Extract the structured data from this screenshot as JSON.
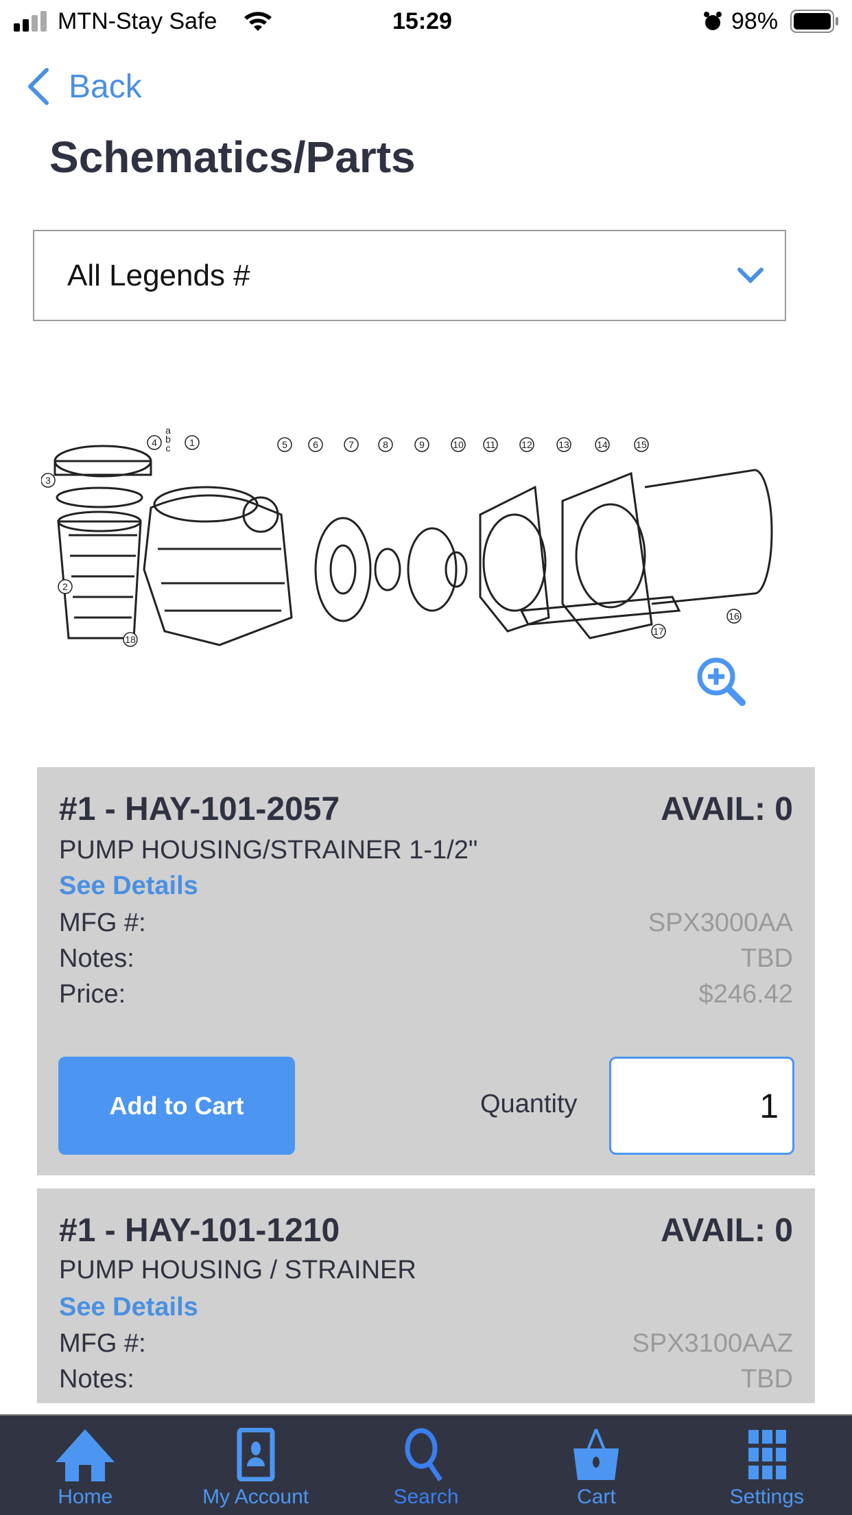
{
  "status_bar": {
    "carrier": "MTN-Stay Safe",
    "time": "15:29",
    "battery": "98%"
  },
  "nav": {
    "back_label": "Back"
  },
  "page": {
    "title": "Schematics/Parts"
  },
  "legend_select": {
    "selected": "All Legends #"
  },
  "schematic": {
    "callouts": [
      "1",
      "2",
      "3",
      "4",
      "5",
      "6",
      "7",
      "8",
      "9",
      "10",
      "11",
      "12",
      "13",
      "14",
      "15",
      "16",
      "17",
      "18"
    ],
    "sub_labels": [
      "a",
      "b",
      "c"
    ]
  },
  "parts": [
    {
      "title": "#1 - HAY-101-2057",
      "avail": "AVAIL: 0",
      "description": "PUMP HOUSING/STRAINER 1-1/2\"",
      "details_link": "See Details",
      "mfg_label": "MFG #:",
      "mfg": "SPX3000AA",
      "notes_label": "Notes:",
      "notes": "TBD",
      "price_label": "Price:",
      "price": "$246.42",
      "add_label": "Add to Cart",
      "qty_label": "Quantity",
      "qty": "1"
    },
    {
      "title": "#1 - HAY-101-1210",
      "avail": "AVAIL: 0",
      "description": "PUMP HOUSING / STRAINER",
      "details_link": "See Details",
      "mfg_label": "MFG #:",
      "mfg": "SPX3100AAZ",
      "notes_label": "Notes:",
      "notes": "TBD"
    }
  ],
  "tabs": [
    {
      "label": "Home",
      "icon": "home-icon"
    },
    {
      "label": "My Account",
      "icon": "account-icon"
    },
    {
      "label": "Search",
      "icon": "search-icon"
    },
    {
      "label": "Cart",
      "icon": "cart-icon"
    },
    {
      "label": "Settings",
      "icon": "grid-icon"
    }
  ],
  "colors": {
    "accent": "#4c96f2",
    "tabbar": "#313543",
    "card": "#d0d0d0"
  }
}
